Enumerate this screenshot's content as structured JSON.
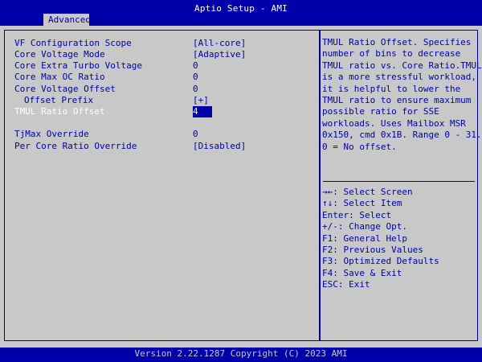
{
  "header": {
    "title": "Aptio Setup - AMI",
    "tabs": [
      {
        "label": "Advanced"
      }
    ]
  },
  "settings": [
    {
      "label": "VF Configuration Scope",
      "value": "[All-core]"
    },
    {
      "label": "Core Voltage Mode",
      "value": "[Adaptive]"
    },
    {
      "label": "Core Extra Turbo Voltage",
      "value": "0"
    },
    {
      "label": "Core Max OC Ratio",
      "value": "0"
    },
    {
      "label": "Core Voltage Offset",
      "value": "0"
    },
    {
      "label": "Offset Prefix",
      "value": "[+]"
    },
    {
      "label": "TMUL Ratio Offset",
      "value": "4"
    },
    {
      "label": "TjMax Override",
      "value": "0"
    },
    {
      "label": "Per Core Ratio Override",
      "value": "[Disabled]"
    }
  ],
  "help": {
    "text": "TMUL Ratio Offset. Specifies\nnumber of bins to decrease\nTMUL ratio vs. Core Ratio.TMUL\nis a more stressful workload,\nit is helpful to lower the\nTMUL ratio to ensure maximum\npossible ratio for SSE\nworkloads. Uses Mailbox MSR\n0x150, cmd 0x1B. Range 0 - 31.\n0 = No offset."
  },
  "keys": [
    "→←: Select Screen",
    "↑↓: Select Item",
    "Enter: Select",
    "+/-: Change Opt.",
    "F1: General Help",
    "F2: Previous Values",
    "F3: Optimized Defaults",
    "F4: Save & Exit",
    "ESC: Exit"
  ],
  "footer": {
    "text": "Version 2.22.1287 Copyright (C) 2023 AMI"
  },
  "colors": {
    "background": "#0000aa",
    "panel": "#c8c8c8",
    "text": "#0000aa",
    "highlight": "#ffffff"
  }
}
